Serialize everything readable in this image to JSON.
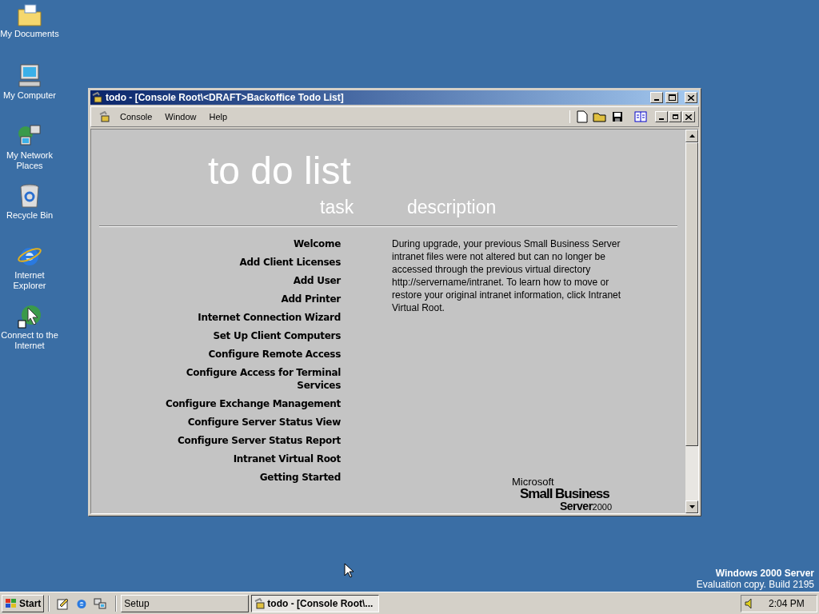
{
  "desktop_icons": [
    {
      "label": "My Documents",
      "kind": "folder"
    },
    {
      "label": "My Computer",
      "kind": "computer"
    },
    {
      "label": "My Network Places",
      "kind": "network"
    },
    {
      "label": "Recycle Bin",
      "kind": "bin"
    },
    {
      "label": "Internet Explorer",
      "kind": "ie"
    },
    {
      "label": "Connect to the Internet",
      "kind": "connect"
    }
  ],
  "window": {
    "title": "todo - [Console Root\\<DRAFT>Backoffice Todo List]",
    "menu": [
      "Console",
      "Window",
      "Help"
    ],
    "page": {
      "heading": "to do list",
      "column_headers": [
        "task",
        "description"
      ],
      "tasks": [
        "Welcome",
        "Add Client Licenses",
        "Add User",
        "Add Printer",
        "Internet Connection Wizard",
        "Set Up Client Computers",
        "Configure Remote Access",
        "Configure Access for Terminal Services",
        "Configure Exchange Management",
        "Configure Server Status View",
        "Configure Server Status Report",
        "Intranet Virtual Root",
        "Getting Started"
      ],
      "description": "During upgrade, your previous Small Business Server intranet files were not altered but can no longer be accessed through the previous virtual directory http://servername/intranet. To learn how to move or restore your original intranet information, click Intranet Virtual Root.",
      "logo": {
        "company": "Microsoft",
        "product": "Small Business",
        "edition": "Server",
        "version": "2000"
      }
    }
  },
  "os_notice": {
    "title": "Windows 2000 Server",
    "subtitle": "Evaluation copy. Build 2195"
  },
  "taskbar": {
    "start": "Start",
    "buttons": [
      {
        "label": "Setup",
        "selected": false
      },
      {
        "label": "todo - [Console Root\\...",
        "selected": true
      }
    ],
    "clock": "2:04 PM"
  }
}
